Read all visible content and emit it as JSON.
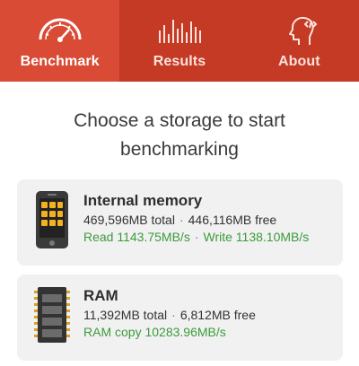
{
  "tabs": [
    {
      "label": "Benchmark",
      "icon": "speedometer-icon",
      "active": true
    },
    {
      "label": "Results",
      "icon": "bar-chart-icon",
      "active": false
    },
    {
      "label": "About",
      "icon": "head-code-icon",
      "active": false
    }
  ],
  "heading": "Choose a storage to start benchmarking",
  "cards": [
    {
      "title": "Internal memory",
      "total": "469,596MB total",
      "free": "446,116MB free",
      "read": "Read 1143.75MB/s",
      "write": "Write 1138.10MB/s",
      "icon": "phone-icon"
    },
    {
      "title": "RAM",
      "total": "11,392MB total",
      "free": "6,812MB free",
      "copy": "RAM copy 10283.96MB/s",
      "icon": "ram-chip-icon"
    }
  ],
  "colors": {
    "accent": "#c43a24",
    "active_tab": "#d94b34",
    "card_bg": "#f1f1f1",
    "speed_green": "#3c9b3c"
  }
}
